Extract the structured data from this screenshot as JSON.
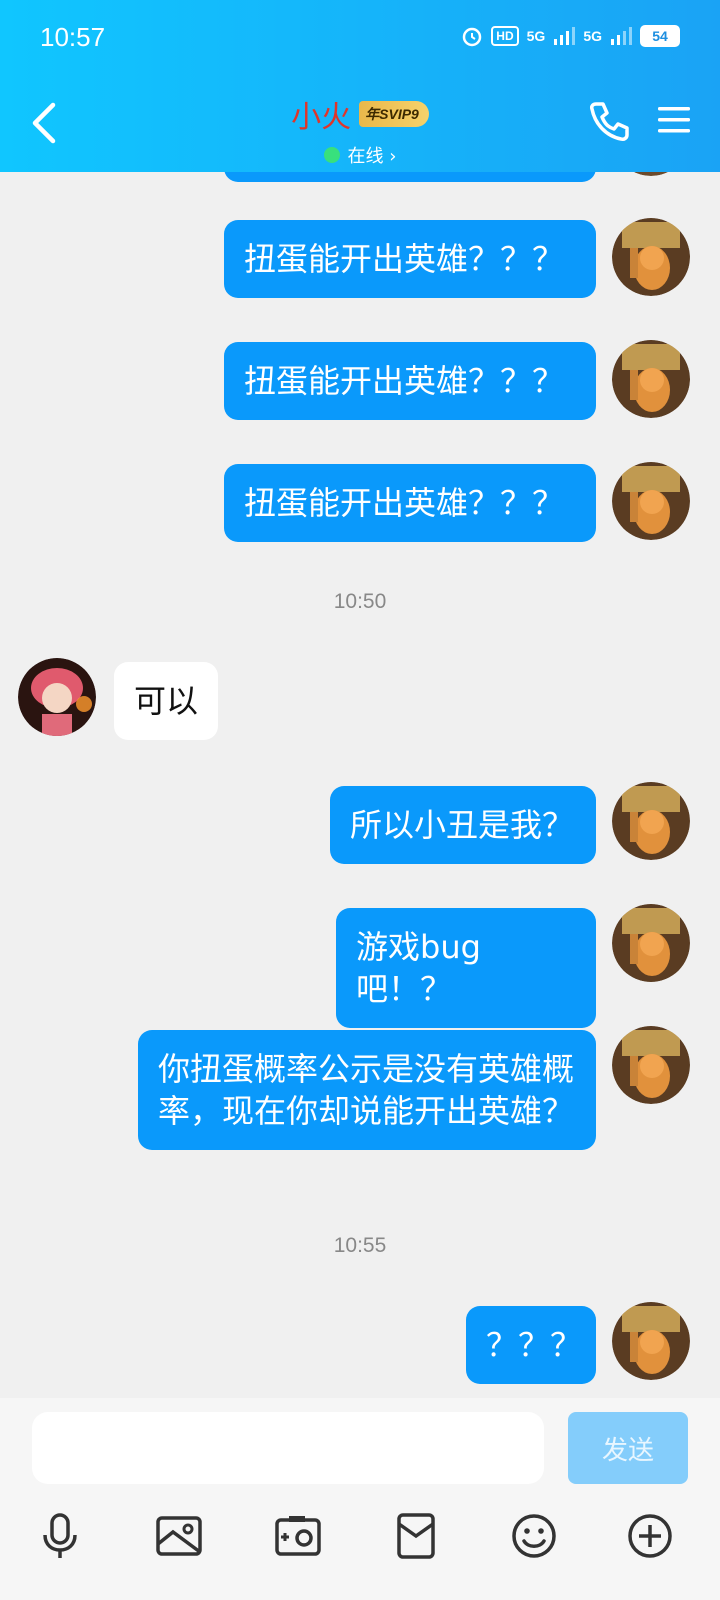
{
  "status_bar": {
    "time": "10:57",
    "hd": "HD",
    "net1": "5G",
    "net2": "5G",
    "battery": "54"
  },
  "header": {
    "contact_name": "小火",
    "badge": "年SVIP9",
    "status": "在线 ›"
  },
  "messages": {
    "out1": "扭蛋能开出英雄？？？",
    "out2": "扭蛋能开出英雄？？？",
    "out3": "扭蛋能开出英雄？？？",
    "ts1": "10:50",
    "in1": "可以",
    "out4": "所以小丑是我？",
    "out5": "游戏bug吧！？",
    "out6": "你扭蛋概率公示是没有英雄概率，现在你却说能开出英雄？",
    "ts2": "10:55",
    "out7": "？？？"
  },
  "composer": {
    "input_value": "",
    "send_label": "发送"
  },
  "colors": {
    "header_start": "#10c6ff",
    "header_end": "#1aa3f5",
    "outgoing_bubble": "#0a99fb",
    "incoming_bubble": "#ffffff",
    "send_disabled": "#84cdfb",
    "name_color": "#e0352a"
  },
  "icons": {
    "back": "back-icon",
    "call": "phone-icon",
    "menu": "menu-icon",
    "tools": [
      "mic-icon",
      "image-icon",
      "camera-icon",
      "red-packet-icon",
      "emoji-icon",
      "plus-icon"
    ]
  }
}
